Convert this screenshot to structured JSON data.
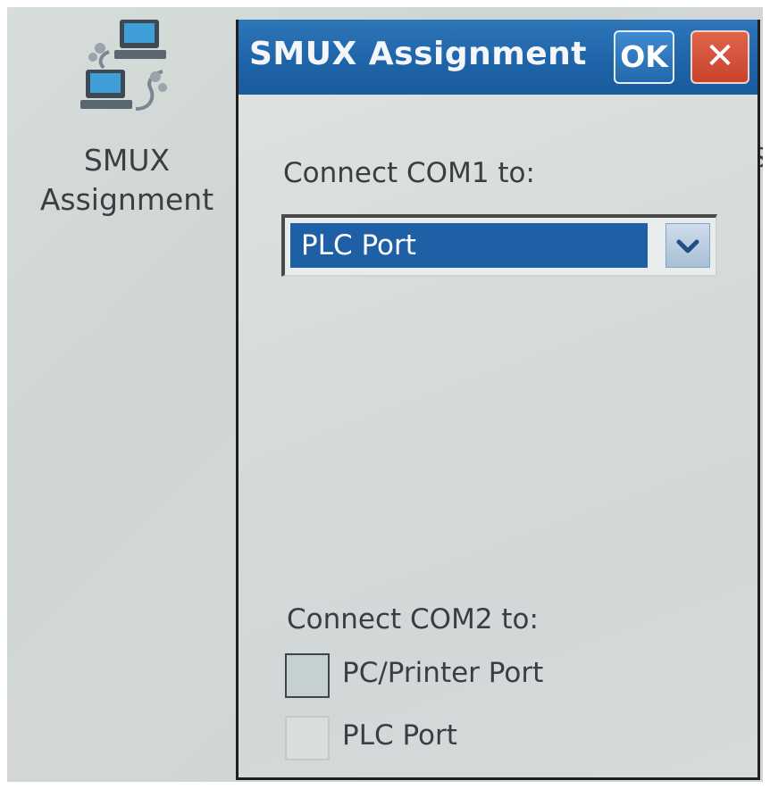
{
  "desktop": {
    "icon": {
      "name": "computers-network-icon",
      "label": "SMUX\nAssignment"
    },
    "edge_glyph": "S"
  },
  "dialog": {
    "title": "SMUX Assignment",
    "ok_label": "OK",
    "close_label": "✕",
    "com1": {
      "label": "Connect COM1 to:",
      "selected": "PLC Port"
    },
    "com2": {
      "label": "Connect COM2 to:",
      "options": [
        {
          "label": "PC/Printer Port"
        },
        {
          "label": "PLC Port"
        }
      ]
    }
  },
  "colors": {
    "titlebar": "#1d63a7",
    "selection": "#1e5fa6",
    "close": "#c8432d"
  }
}
